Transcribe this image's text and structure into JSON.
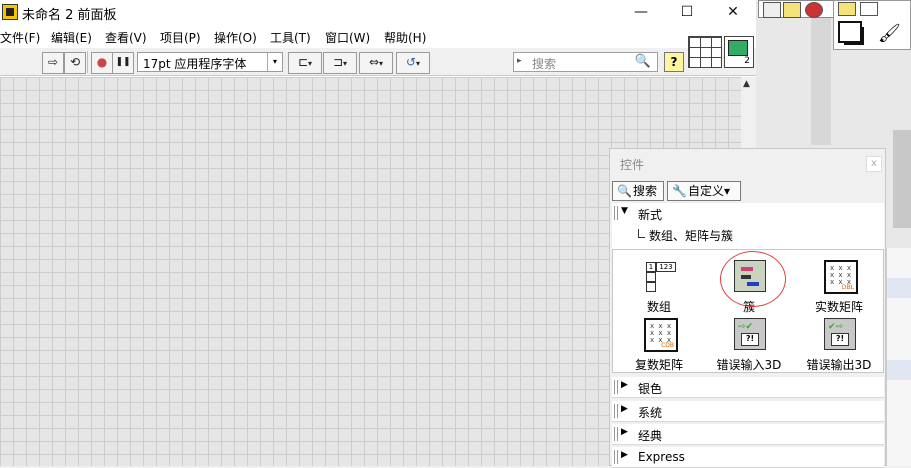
{
  "window": {
    "title": "未命名 2 前面板",
    "controls": {
      "minimize": "—",
      "maximize": "☐",
      "close": "✕"
    }
  },
  "menubar": {
    "items": [
      "文件(F)",
      "编辑(E)",
      "查看(V)",
      "项目(P)",
      "操作(O)",
      "工具(T)",
      "窗口(W)",
      "帮助(H)"
    ]
  },
  "toolbar": {
    "run_icon": "⇨",
    "run_continuous_icon": "⟲",
    "abort_icon": "●",
    "pause_icon": "❚❚",
    "font_value": "17pt 应用程序字体",
    "align_icon": "⊏",
    "distribute_icon": "⊐",
    "resize_icon": "⇔",
    "reorder_icon": "↺",
    "dropdown_arrow": "▾",
    "search_placeholder": "搜索",
    "search_icon": "🔍",
    "help_label": "?",
    "vi_icon_number": "2"
  },
  "palette": {
    "title": "控件",
    "close": "x",
    "search_button": "搜索",
    "customize_button": "自定义▾",
    "search_icon": "🔍",
    "customize_icon": "🔧",
    "expanded_category": "新式",
    "subpath": "数组、矩阵与簇",
    "items": [
      {
        "label": "数组",
        "icon": "array-icon"
      },
      {
        "label": "簇",
        "icon": "cluster-icon"
      },
      {
        "label": "实数矩阵",
        "icon": "real-matrix-icon",
        "tag": "DBL"
      },
      {
        "label": "复数矩阵",
        "icon": "complex-matrix-icon",
        "tag": "CDB"
      },
      {
        "label": "错误输入3D",
        "icon": "error-in-icon"
      },
      {
        "label": "错误输出3D",
        "icon": "error-out-icon"
      }
    ],
    "array_icon_text": {
      "index": "1",
      "values": "123"
    },
    "matrix_icon_text": "x x x\nx x x\nx x x",
    "error_icon_text": "?!",
    "categories": [
      "银色",
      "系统",
      "经典",
      "Express"
    ]
  },
  "colors": {
    "canvas": "#e6e6e6",
    "grid_line": "#cdcdcd",
    "highlight_ring": "#e04040"
  }
}
